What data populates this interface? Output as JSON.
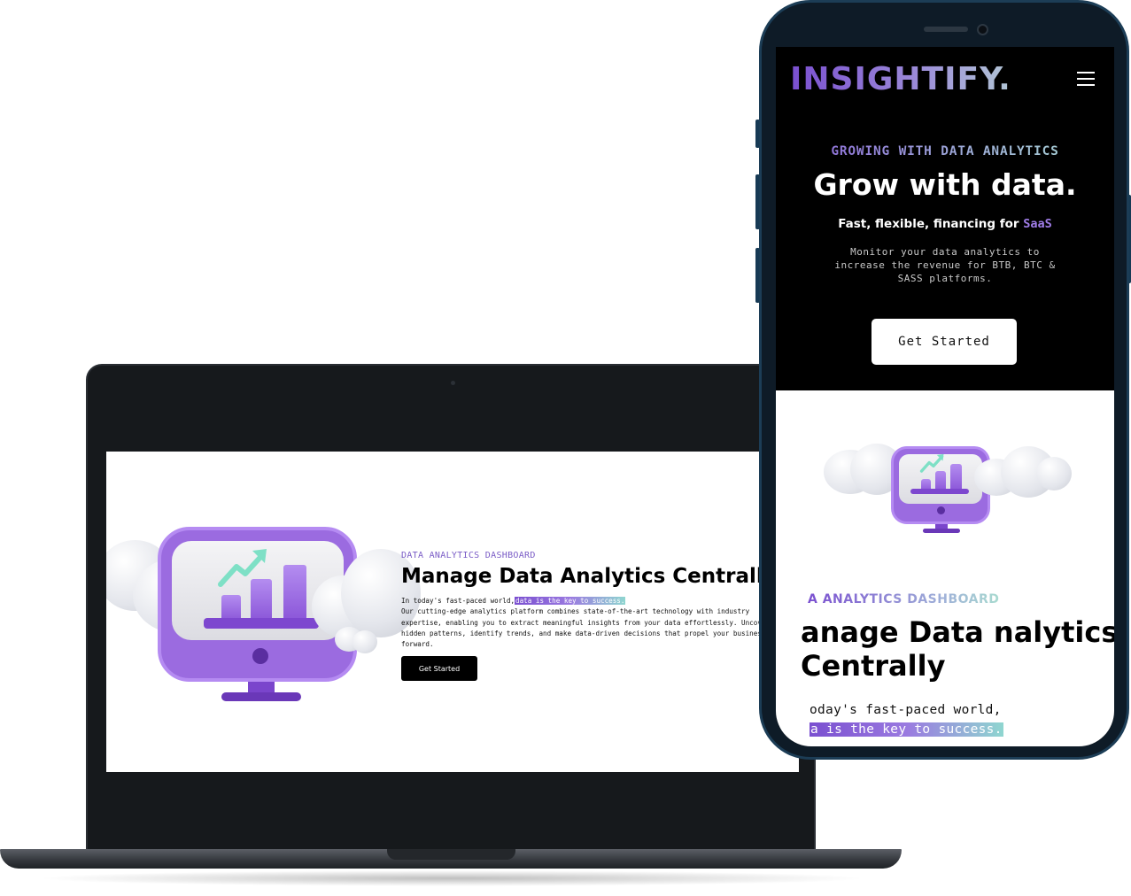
{
  "laptop": {
    "section_tag": "DATA ANALYTICS DASHBOARD",
    "title": "Manage Data Analytics Centrally",
    "intro": "In today's fast-paced world,",
    "highlight": "data is the key to success.",
    "body": "Our cutting-edge analytics platform combines state-of-the-art technology with industry expertise, enabling you to extract meaningful insights from your data effortlessly. Uncover hidden patterns, identify trends, and make data-driven decisions that propel your business forward.",
    "cta_label": "Get Started"
  },
  "phone": {
    "logo": "INSIGHTIFY.",
    "menu_icon": "hamburger-menu-icon",
    "subheading": "GROWING WITH DATA ANALYTICS",
    "headline": "Grow with data.",
    "tagline_prefix": "Fast, flexible, financing for",
    "tagline_accent": "SaaS",
    "description": "Monitor your data analytics to increase the revenue for BTB, BTC & SASS platforms.",
    "cta_label": "Get Started",
    "section_tag": "A ANALYTICS DASHBOARD",
    "title": "anage Data nalytics Centrally",
    "intro": "oday's fast-paced world,",
    "highlight": "a is the key to success."
  },
  "colors": {
    "accent_purple": "#7a4fd0",
    "accent_teal": "#8fd6d0",
    "phone_frame": "#0e1b27",
    "laptop_frame": "#16191c"
  }
}
